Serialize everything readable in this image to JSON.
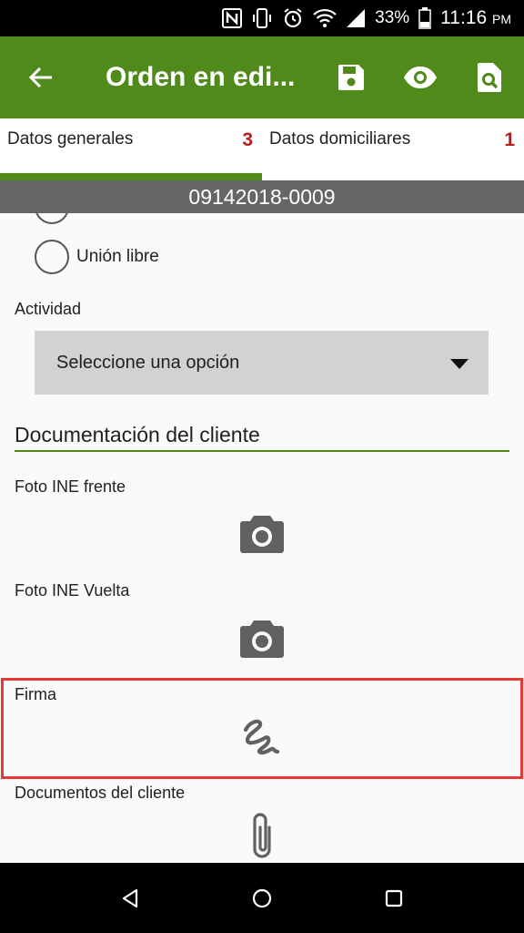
{
  "status_bar": {
    "battery": "33%",
    "time": "11:16",
    "time_suffix": "PM",
    "icons": [
      "nfc-icon",
      "vibrate-icon",
      "alarm-icon",
      "wifi-icon",
      "signal-icon",
      "battery-icon"
    ]
  },
  "app_bar": {
    "title": "Orden en edi...",
    "color": "#4f8a1a",
    "actions": [
      "save-icon",
      "eye-icon",
      "search-document-icon"
    ]
  },
  "tabs": [
    {
      "label": "Datos generales",
      "count": "3",
      "selected": true
    },
    {
      "label": "Datos domiciliares",
      "count": "1",
      "selected": false
    }
  ],
  "order_number": "09142018-0009",
  "form": {
    "radio_option": "Unión libre",
    "actividad_label": "Actividad",
    "actividad_value": "Seleccione una opción",
    "section_title": "Documentación del cliente",
    "photo_front_label": "Foto INE frente",
    "photo_back_label": "Foto INE Vuelta",
    "signature_label": "Firma",
    "documents_label": "Documentos del cliente"
  },
  "highlight_color": "#e53935",
  "nav_bar": [
    "back-icon",
    "home-icon",
    "recents-icon"
  ]
}
